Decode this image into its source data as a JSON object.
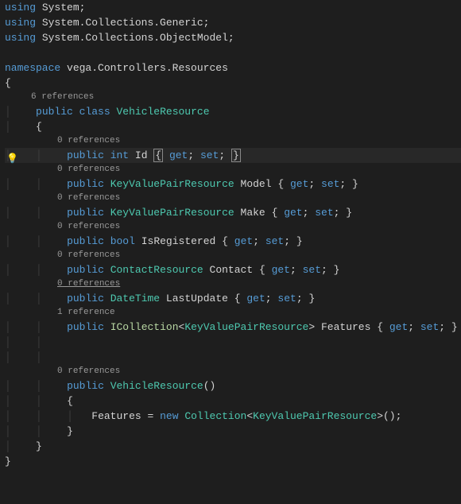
{
  "code": {
    "using": "using",
    "system": "System",
    "collections_generic": "System.Collections.Generic",
    "collections_objectmodel": "System.Collections.ObjectModel",
    "namespace_kw": "namespace",
    "namespace_name": "vega.Controllers.Resources",
    "public": "public",
    "class_kw": "class",
    "class_name": "VehicleResource",
    "int": "int",
    "bool": "bool",
    "get": "get",
    "set": "set",
    "new": "new",
    "kvpr": "KeyValuePairResource",
    "contactres": "ContactResource",
    "datetime": "DateTime",
    "icollection": "ICollection",
    "collection": "Collection",
    "prop_id": "Id",
    "prop_model": "Model",
    "prop_make": "Make",
    "prop_isreg": "IsRegistered",
    "prop_contact": "Contact",
    "prop_lastupdate": "LastUpdate",
    "prop_features": "Features",
    "ctor_name": "VehicleResource",
    "eq": " = "
  },
  "refs": {
    "r6": "6 references",
    "r0": "0 references",
    "r1": "1 reference"
  },
  "icons": {
    "lightbulb": "💡"
  }
}
